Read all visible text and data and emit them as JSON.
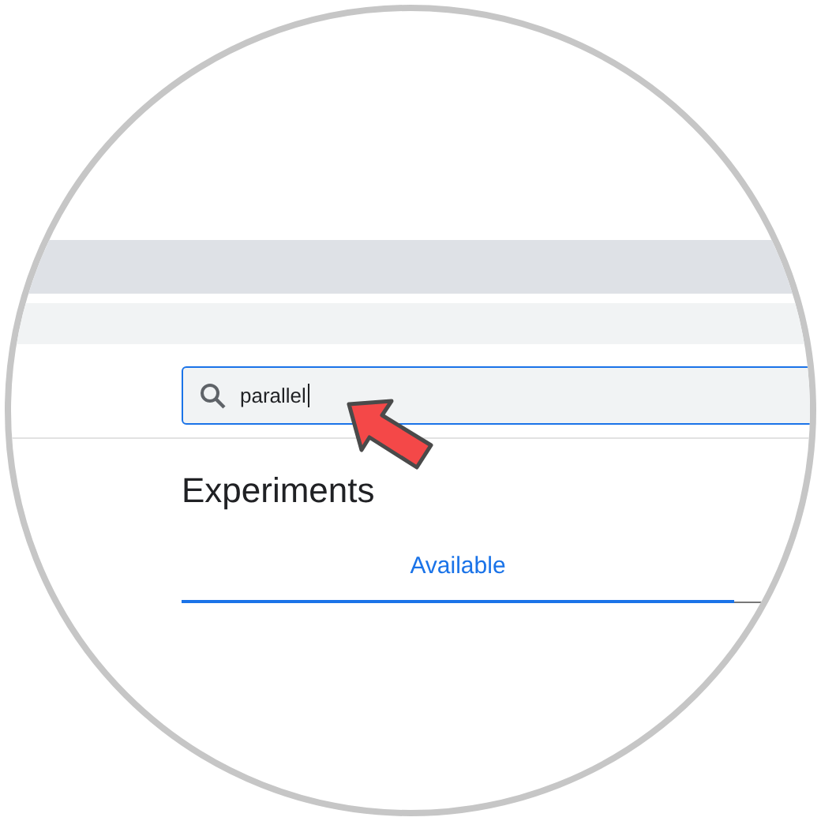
{
  "search": {
    "value": "parallel"
  },
  "heading": "Experiments",
  "tabs": [
    {
      "label": "Available",
      "selected": true
    }
  ]
}
